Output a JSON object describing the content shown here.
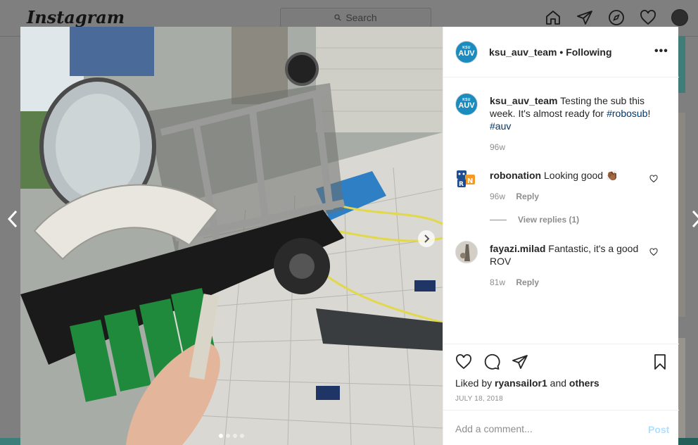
{
  "nav": {
    "logo": "Instagram",
    "search_placeholder": "Search",
    "icons": [
      "home-icon",
      "direct-icon",
      "explore-icon",
      "activity-heart-icon",
      "profile-avatar"
    ]
  },
  "post": {
    "username": "ksu_auv_team",
    "follow_status": "Following",
    "avatar_text_small": "KSU",
    "avatar_text_big": "AUV",
    "more_label": "•••",
    "caption": {
      "username": "ksu_auv_team",
      "text": "Testing the sub this week. It's almost ready for",
      "hashtag1": "#robosub",
      "after": "!",
      "hashtag2": "#auv",
      "time": "96w"
    },
    "comments": [
      {
        "username": "robonation",
        "text": "Looking good",
        "emoji": "👏🏾",
        "time": "96w",
        "reply_label": "Reply"
      },
      {
        "username": "fayazi.milad",
        "text": "Fantastic, it's a good ROV",
        "time": "81w",
        "reply_label": "Reply"
      }
    ],
    "view_replies": "View replies (1)",
    "liked_prefix": "Liked by",
    "liked_user": "ryansailor1",
    "liked_and": "and",
    "liked_others": "others",
    "date": "JULY 18, 2018",
    "comment_placeholder": "Add a comment...",
    "post_label": "Post",
    "carousel": {
      "slides": 4,
      "active_index": 0
    }
  },
  "colors": {
    "overlay": "#7f7f7f",
    "link": "#00376b",
    "avatar_blue": "#1c8bbd",
    "post_disabled": "#b2dffc"
  }
}
